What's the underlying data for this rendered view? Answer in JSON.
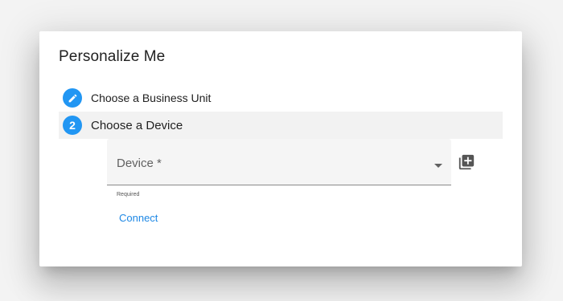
{
  "dialog": {
    "title": "Personalize Me"
  },
  "stepper": {
    "steps": [
      {
        "indicator": "edit-icon",
        "label": "Choose a Business Unit",
        "state": "completed"
      },
      {
        "indicator": "2",
        "label": "Choose a Device",
        "state": "active"
      }
    ]
  },
  "device_field": {
    "label": "Device *",
    "value": "",
    "hint": "Required",
    "icon": "dropdown-arrow-icon"
  },
  "add_device_button": {
    "icon": "library-add-icon"
  },
  "connect_button": {
    "label": "Connect"
  },
  "colors": {
    "accent": "#2196f3",
    "link": "#1e88e5",
    "active_step_bg": "#f2f2f2",
    "field_bg": "#f5f5f5"
  }
}
